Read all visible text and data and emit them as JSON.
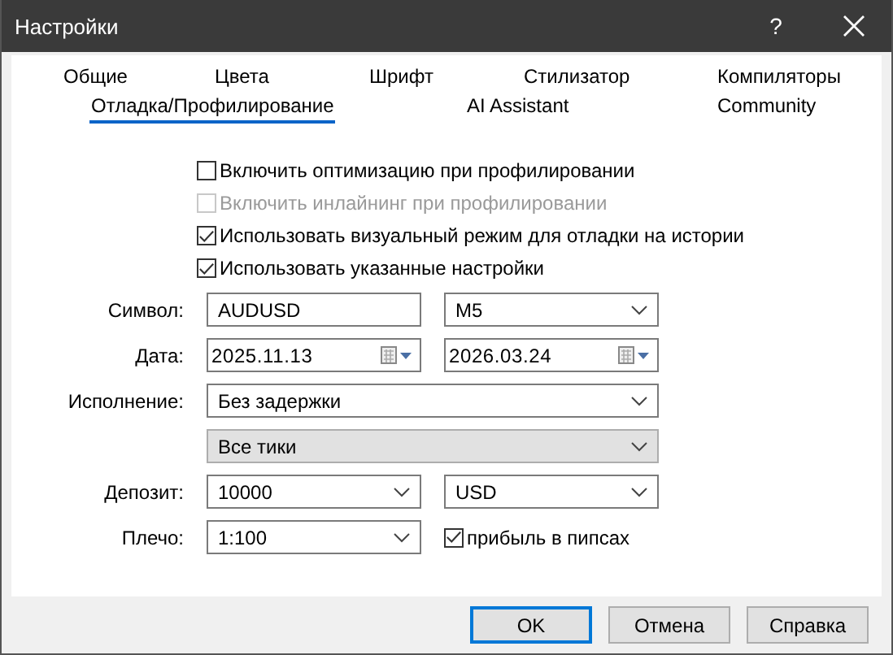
{
  "window": {
    "title": "Настройки",
    "help": "?"
  },
  "tab_rows": [
    [
      {
        "label": "Общие",
        "selected": false
      },
      {
        "label": "Цвета",
        "selected": false
      },
      {
        "label": "Шрифт",
        "selected": false
      },
      {
        "label": "Стилизатор",
        "selected": false
      },
      {
        "label": "Компиляторы",
        "selected": false
      }
    ],
    [
      {
        "label": "Отладка/Профилирование",
        "selected": true
      },
      {
        "label": "AI Assistant",
        "selected": false
      },
      {
        "label": "Community",
        "selected": false
      }
    ]
  ],
  "checkboxes": [
    {
      "label": "Включить оптимизацию при профилировании",
      "checked": false,
      "disabled": false
    },
    {
      "label": "Включить инлайнинг при профилировании",
      "checked": false,
      "disabled": true
    },
    {
      "label": "Использовать визуальный режим для отладки на истории",
      "checked": true,
      "disabled": false
    },
    {
      "label": "Использовать указанные настройки",
      "checked": true,
      "disabled": false
    }
  ],
  "form_rows": [
    {
      "label": "Символ:",
      "controls": [
        {
          "kind": "text",
          "value": "AUDUSD"
        },
        {
          "kind": "combo",
          "value": "M5"
        }
      ]
    },
    {
      "label": "Дата:",
      "controls": [
        {
          "kind": "date",
          "value": "2025.11.13"
        },
        {
          "kind": "date",
          "value": "2026.03.24"
        }
      ]
    },
    {
      "label": "Исполнение:",
      "controls": [
        {
          "kind": "combo",
          "value": "Без задержки"
        }
      ]
    },
    {
      "controls": [
        {
          "kind": "dropdown",
          "value": "Все тики"
        }
      ]
    },
    {
      "label": "Депозит:",
      "controls": [
        {
          "kind": "combo",
          "value": "10000"
        },
        {
          "kind": "combo",
          "value": "USD"
        }
      ]
    },
    {
      "label": "Плечо:",
      "controls": [
        {
          "kind": "combo",
          "value": "1:100"
        },
        {
          "kind": "checkbox",
          "label": "прибыль в пипсах",
          "checked": true
        }
      ]
    }
  ],
  "buttons": [
    {
      "label": "OK",
      "default": true
    },
    {
      "label": "Отмена",
      "default": false
    },
    {
      "label": "Справка",
      "default": false
    }
  ]
}
